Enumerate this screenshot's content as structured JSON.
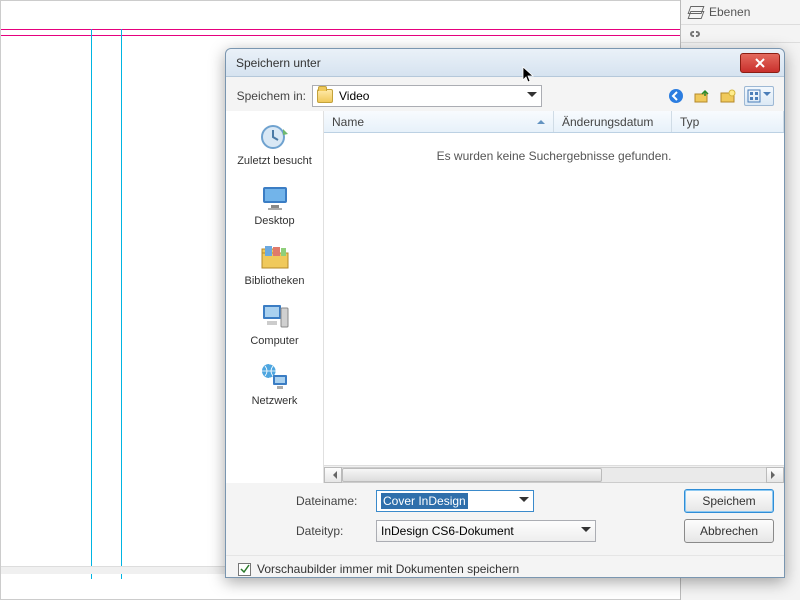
{
  "side_panel": {
    "layers_label": "Ebenen"
  },
  "dialog": {
    "title": "Speichern unter",
    "save_in_label": "Speichem in:",
    "folder_name": "Video",
    "columns": {
      "name": "Name",
      "date": "Änderungsdatum",
      "type": "Typ"
    },
    "empty_message": "Es wurden keine Suchergebnisse gefunden.",
    "filename_label": "Dateiname:",
    "filename_value": "Cover InDesign",
    "filetype_label": "Dateityp:",
    "filetype_value": "InDesign CS6-Dokument",
    "save_btn": "Speichem",
    "cancel_btn": "Abbrechen",
    "thumbs_checkbox": "Vorschaubilder immer mit Dokumenten speichern",
    "places": {
      "recent": "Zuletzt besucht",
      "desktop": "Desktop",
      "libraries": "Bibliotheken",
      "computer": "Computer",
      "network": "Netzwerk"
    }
  }
}
